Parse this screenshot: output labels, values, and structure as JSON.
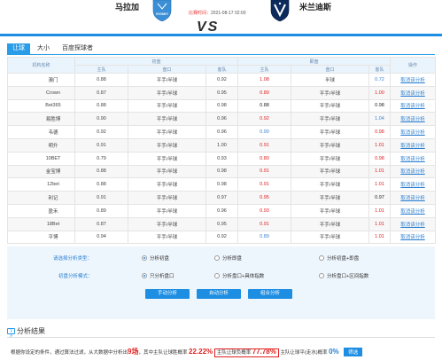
{
  "header": {
    "home_team": "马拉加",
    "away_team": "米兰迪斯",
    "home_logo_text": "SYDNEY",
    "match_time_label": "比赛时间：",
    "match_time": "2021-08-17 02:00",
    "vs": "VS"
  },
  "tabs": [
    {
      "label": "让球"
    },
    {
      "label": "大小"
    },
    {
      "label": "百度探球者"
    }
  ],
  "table": {
    "col_company": "机构名称",
    "grp_initial": "初盘",
    "grp_live": "即盘",
    "col_action": "操作",
    "sub_home": "主队",
    "sub_line": "盘口",
    "sub_away": "客队",
    "rows": [
      {
        "company": "澳门",
        "i_home": "0.88",
        "i_line": "平手/半球",
        "i_away": "0.92",
        "l_home": "1.08",
        "l_line": "半球",
        "l_away": "0.72",
        "lh": "red",
        "la": "blue",
        "action": "取消该分析"
      },
      {
        "company": "Crown",
        "i_home": "0.87",
        "i_line": "平手/半球",
        "i_away": "0.95",
        "l_home": "0.89",
        "l_line": "平手/半球",
        "l_away": "1.00",
        "lh": "red",
        "la": "red",
        "action": "取消该分析"
      },
      {
        "company": "Bet365",
        "i_home": "0.88",
        "i_line": "平手/半球",
        "i_away": "0.98",
        "l_home": "0.88",
        "l_line": "平手/半球",
        "l_away": "0.98",
        "lh": "blk",
        "la": "blk",
        "action": "取消该分析"
      },
      {
        "company": "易胜博",
        "i_home": "0.90",
        "i_line": "平手/半球",
        "i_away": "0.96",
        "l_home": "0.92",
        "l_line": "平手/半球",
        "l_away": "1.04",
        "lh": "red",
        "la": "blue",
        "action": "取消该分析"
      },
      {
        "company": "韦德",
        "i_home": "0.92",
        "i_line": "平手/半球",
        "i_away": "0.96",
        "l_home": "0.90",
        "l_line": "平手/半球",
        "l_away": "0.98",
        "lh": "blue",
        "la": "red",
        "action": "取消该分析"
      },
      {
        "company": "明升",
        "i_home": "0.91",
        "i_line": "平手/半球",
        "i_away": "1.00",
        "l_home": "0.91",
        "l_line": "平手/半球",
        "l_away": "1.01",
        "lh": "red",
        "la": "red",
        "action": "取消该分析"
      },
      {
        "company": "10BET",
        "i_home": "0.79",
        "i_line": "平手/半球",
        "i_away": "0.93",
        "l_home": "0.80",
        "l_line": "平手/半球",
        "l_away": "0.98",
        "lh": "red",
        "la": "red",
        "action": "取消该分析"
      },
      {
        "company": "金宝博",
        "i_home": "0.88",
        "i_line": "平手/半球",
        "i_away": "0.98",
        "l_home": "0.91",
        "l_line": "平手/半球",
        "l_away": "1.01",
        "lh": "red",
        "la": "red",
        "action": "取消该分析"
      },
      {
        "company": "12bet",
        "i_home": "0.88",
        "i_line": "平手/半球",
        "i_away": "0.98",
        "l_home": "0.91",
        "l_line": "平手/半球",
        "l_away": "1.01",
        "lh": "red",
        "la": "red",
        "action": "取消该分析"
      },
      {
        "company": "利记",
        "i_home": "0.91",
        "i_line": "平手/半球",
        "i_away": "0.97",
        "l_home": "0.95",
        "l_line": "平手/半球",
        "l_away": "0.97",
        "lh": "red",
        "la": "blk",
        "action": "取消该分析"
      },
      {
        "company": "盈禾",
        "i_home": "0.89",
        "i_line": "平手/半球",
        "i_away": "0.96",
        "l_home": "0.93",
        "l_line": "平手/半球",
        "l_away": "1.01",
        "lh": "red",
        "la": "red",
        "action": "取消该分析"
      },
      {
        "company": "18Bet",
        "i_home": "0.87",
        "i_line": "平手/半球",
        "i_away": "0.95",
        "l_home": "0.91",
        "l_line": "平手/半球",
        "l_away": "1.01",
        "lh": "red",
        "la": "red",
        "action": "取消该分析"
      },
      {
        "company": "平博",
        "i_home": "0.94",
        "i_line": "平手/半球",
        "i_away": "0.92",
        "l_home": "0.89",
        "l_line": "平手/半球",
        "l_away": "1.01",
        "lh": "blue",
        "la": "red",
        "action": "取消该分析"
      }
    ]
  },
  "options": {
    "type_label": "请选择分析类型：",
    "type_opts": [
      "分析初盘",
      "分析即盘",
      "分析初盘+即盘"
    ],
    "mode_label": "初盘分析模式：",
    "mode_opts": [
      "只分析盘口",
      "分析盘口+具体指数",
      "分析盘口+区间指数"
    ],
    "buttons": [
      "手动分析",
      "自动分析",
      "组合分析"
    ]
  },
  "results": {
    "icon_text": "下注",
    "title": "分析结果",
    "t1": "根据你设定的条件，通过算法过滤，从大数据中分析出",
    "count": "9场",
    "t2": "，其中主队让球胜概率",
    "win_pct": "22.22%",
    "t3": "主队让球负概率",
    "lose_pct": "77.78%",
    "t4": "主队让球平(走水)概率",
    "draw_pct": "0%",
    "filter": "筛选"
  },
  "colors": {
    "accent": "#1e8ee3",
    "red": "#e02020",
    "blue": "#3b82d8"
  }
}
